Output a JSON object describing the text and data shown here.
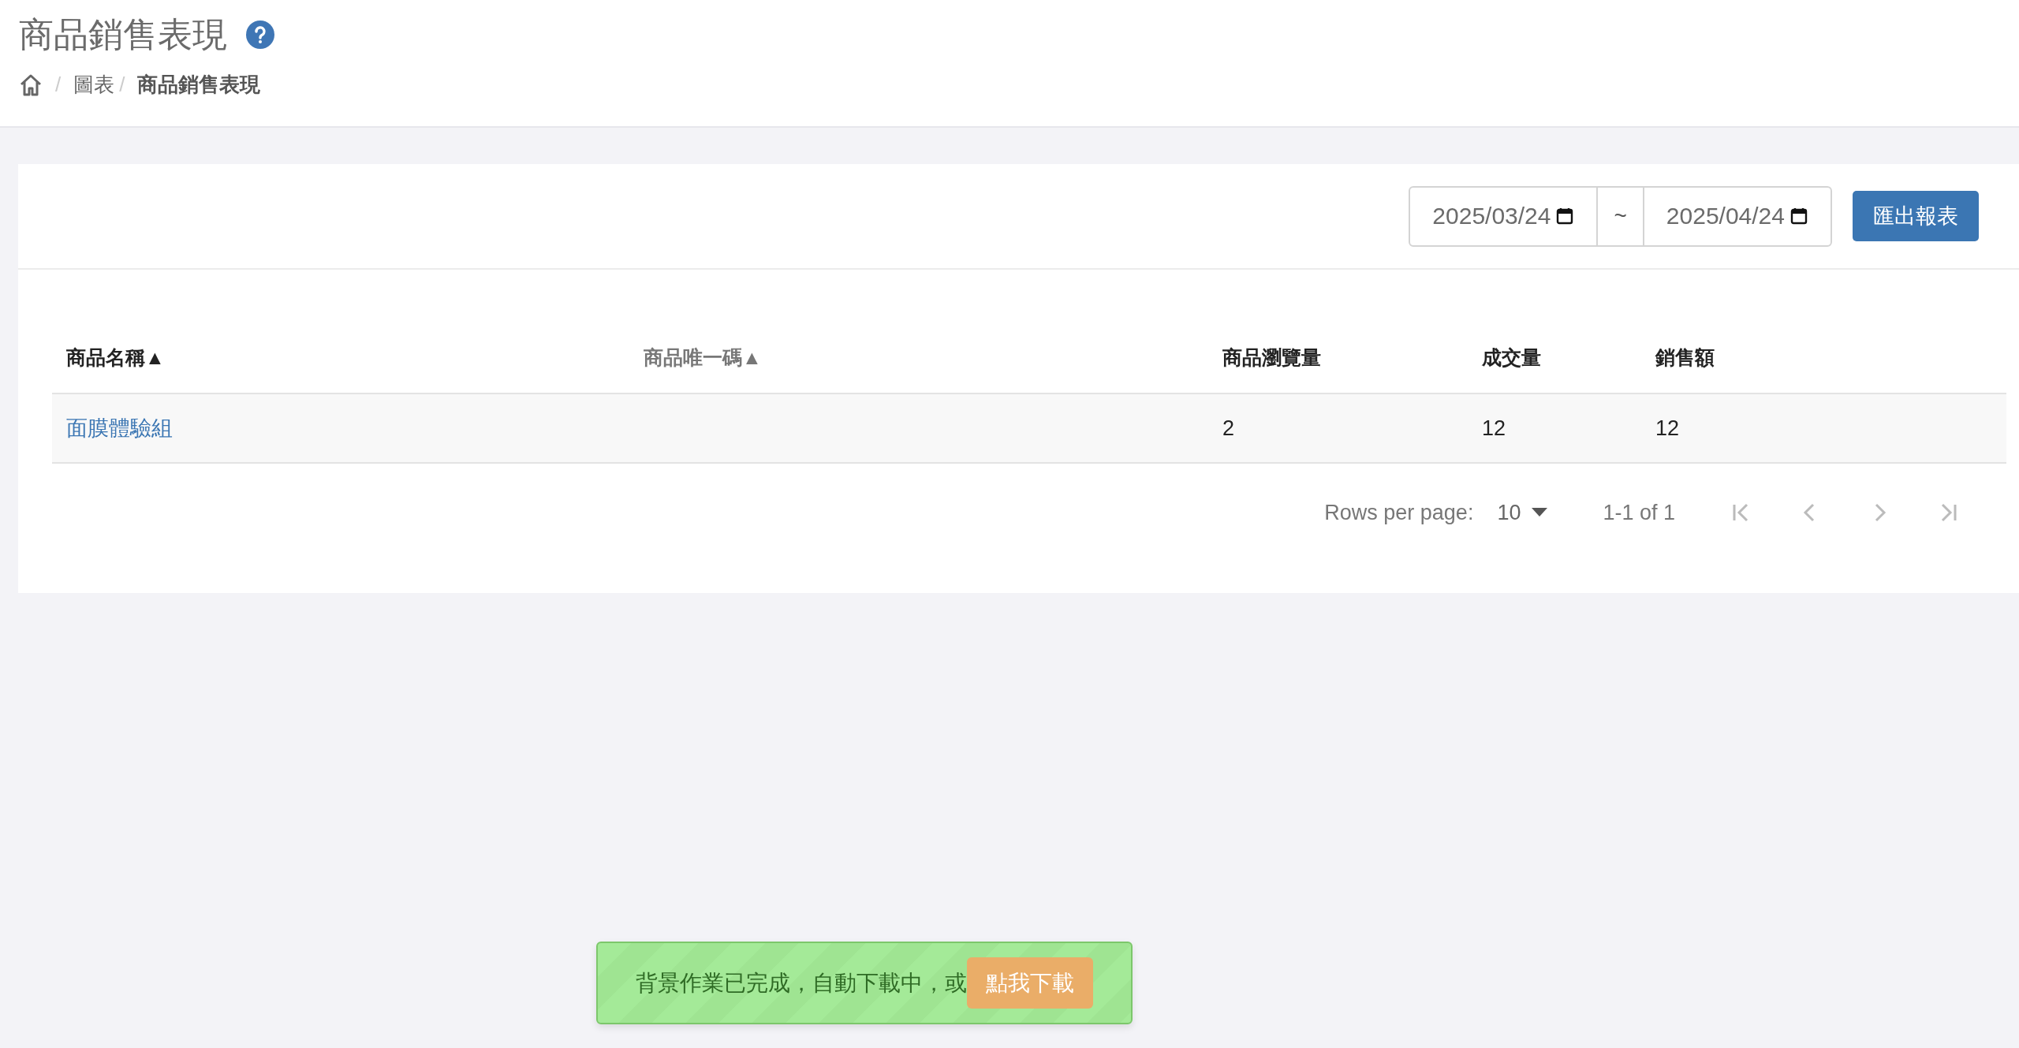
{
  "page": {
    "title": "商品銷售表現"
  },
  "breadcrumb": [
    {
      "separator": "/",
      "label": "圖表",
      "current": false
    },
    {
      "separator": "/",
      "label": "商品銷售表現",
      "current": true
    }
  ],
  "date_range": {
    "start": "2025/03/24",
    "separator": "~",
    "end": "2025/04/24"
  },
  "export_button": "匯出報表",
  "table": {
    "columns": [
      {
        "label": "商品名稱",
        "sort_arrow": "▲",
        "selected": true
      },
      {
        "label": "商品唯一碼",
        "sort_arrow": "▲",
        "selected": false
      },
      {
        "label": "商品瀏覽量"
      },
      {
        "label": "成交量"
      },
      {
        "label": "銷售額"
      }
    ],
    "rows": [
      {
        "cells": [
          "面膜體驗組",
          "",
          "2",
          "12",
          "12"
        ]
      }
    ]
  },
  "pagination": {
    "rows_per_page_label": "Rows per page:",
    "rows_per_page": "10",
    "range": "1-1 of 1",
    "buttons": [
      {
        "kind": "first",
        "disabled": true
      },
      {
        "kind": "prev",
        "disabled": true
      },
      {
        "kind": "next",
        "disabled": true
      },
      {
        "kind": "last",
        "disabled": true
      }
    ]
  },
  "toast": {
    "message": "背景作業已完成，自動下載中，或",
    "button": "點我下載"
  }
}
